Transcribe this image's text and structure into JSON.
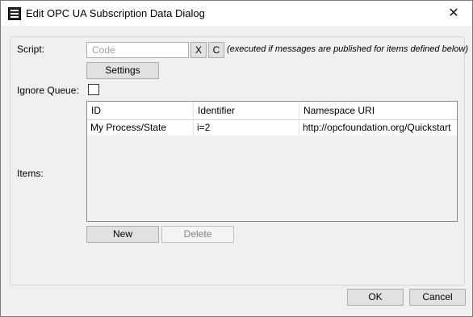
{
  "window": {
    "title": "Edit OPC UA Subscription Data Dialog",
    "close_glyph": "✕"
  },
  "script": {
    "label": "Script:",
    "placeholder": "Code",
    "value": "",
    "x_label": "X",
    "c_label": "C",
    "note": "(executed if messages are published for items defined below)",
    "settings_label": "Settings"
  },
  "ignore_queue": {
    "label": "Ignore Queue:",
    "checked": false
  },
  "items": {
    "label": "Items:",
    "columns": [
      "ID",
      "Identifier",
      "Namespace URI"
    ],
    "rows": [
      [
        "My Process/State",
        "i=2",
        "http://opcfoundation.org/Quickstart"
      ]
    ],
    "new_label": "New",
    "delete_label": "Delete"
  },
  "footer": {
    "ok_label": "OK",
    "cancel_label": "Cancel"
  },
  "icons": {
    "app": "app-logo-icon",
    "close": "close-icon"
  }
}
